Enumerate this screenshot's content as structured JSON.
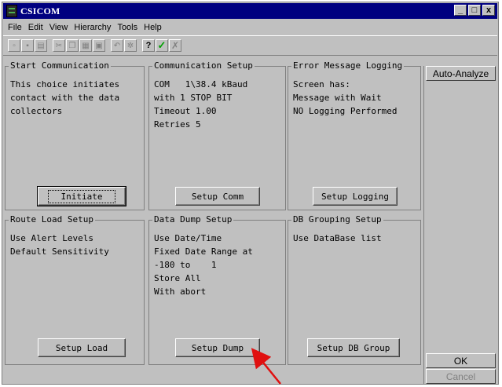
{
  "window": {
    "title": "CSICOM",
    "min": "_",
    "max": "□",
    "close": "x"
  },
  "menu": [
    "File",
    "Edit",
    "View",
    "Hierarchy",
    "Tools",
    "Help"
  ],
  "toolbar": {
    "help": "?",
    "check": "✓",
    "cross": "✗"
  },
  "panels": {
    "start": {
      "title": "Start Communication",
      "lines": "This choice initiates\ncontact with the data\ncollectors",
      "button": "Initiate"
    },
    "comm": {
      "title": "Communication Setup",
      "lines": "COM   1\\38.4 kBaud\nwith 1 STOP BIT\nTimeout 1.00\nRetries 5",
      "button": "Setup Comm"
    },
    "error": {
      "title": "Error Message Logging",
      "lines": "Screen has:\nMessage with Wait\nNO Logging Performed",
      "button": "Setup Logging"
    },
    "route": {
      "title": "Route Load Setup",
      "lines": "Use Alert Levels\nDefault Sensitivity",
      "button": "Setup Load"
    },
    "dump": {
      "title": "Data Dump Setup",
      "lines": "Use Date/Time\nFixed Date Range at\n-180 to    1\nStore All\nWith abort",
      "button": "Setup Dump"
    },
    "db": {
      "title": "DB Grouping Setup",
      "lines": "Use DataBase list",
      "button": "Setup DB Group"
    }
  },
  "side": {
    "auto_analyze": "Auto-Analyze",
    "ok": "OK",
    "cancel": "Cancel"
  },
  "annotation": {
    "arrow_color": "#e01010"
  }
}
